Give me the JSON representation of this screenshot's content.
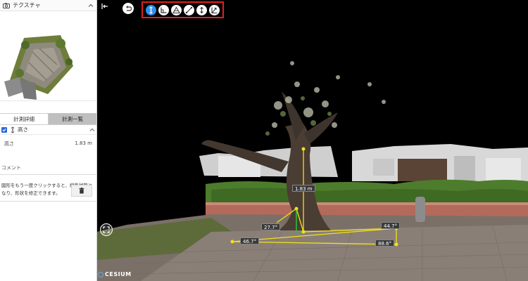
{
  "panel": {
    "title": "テクスチャ"
  },
  "tabs": {
    "detail": "計測詳細",
    "list": "計測一覧"
  },
  "measurement_item": {
    "name": "高さ"
  },
  "property": {
    "label": "高さ",
    "value": "1.83 m"
  },
  "comment": {
    "label": "コメント"
  },
  "hint": {
    "text": "図形をもう一度クリックすると、編集状態となり、形状を修正できます。"
  },
  "toolbar": {
    "tools": [
      "height-tool",
      "area-tool",
      "triangle-tool",
      "distance-tool",
      "vertical-tool",
      "slope-tool"
    ],
    "active_tool": "height-tool"
  },
  "measurements": {
    "height": "1.83 m",
    "angle_a": "27.7°",
    "angle_b": "44.7°",
    "angle_c": "46.7°",
    "angle_d": "88.6°"
  },
  "attribution": {
    "logo": "CESIUM"
  },
  "colors": {
    "accent": "#2f8ff0",
    "highlight_border": "#e02020",
    "measure_yellow": "#f2e21a",
    "measure_green": "#2dc23a"
  }
}
